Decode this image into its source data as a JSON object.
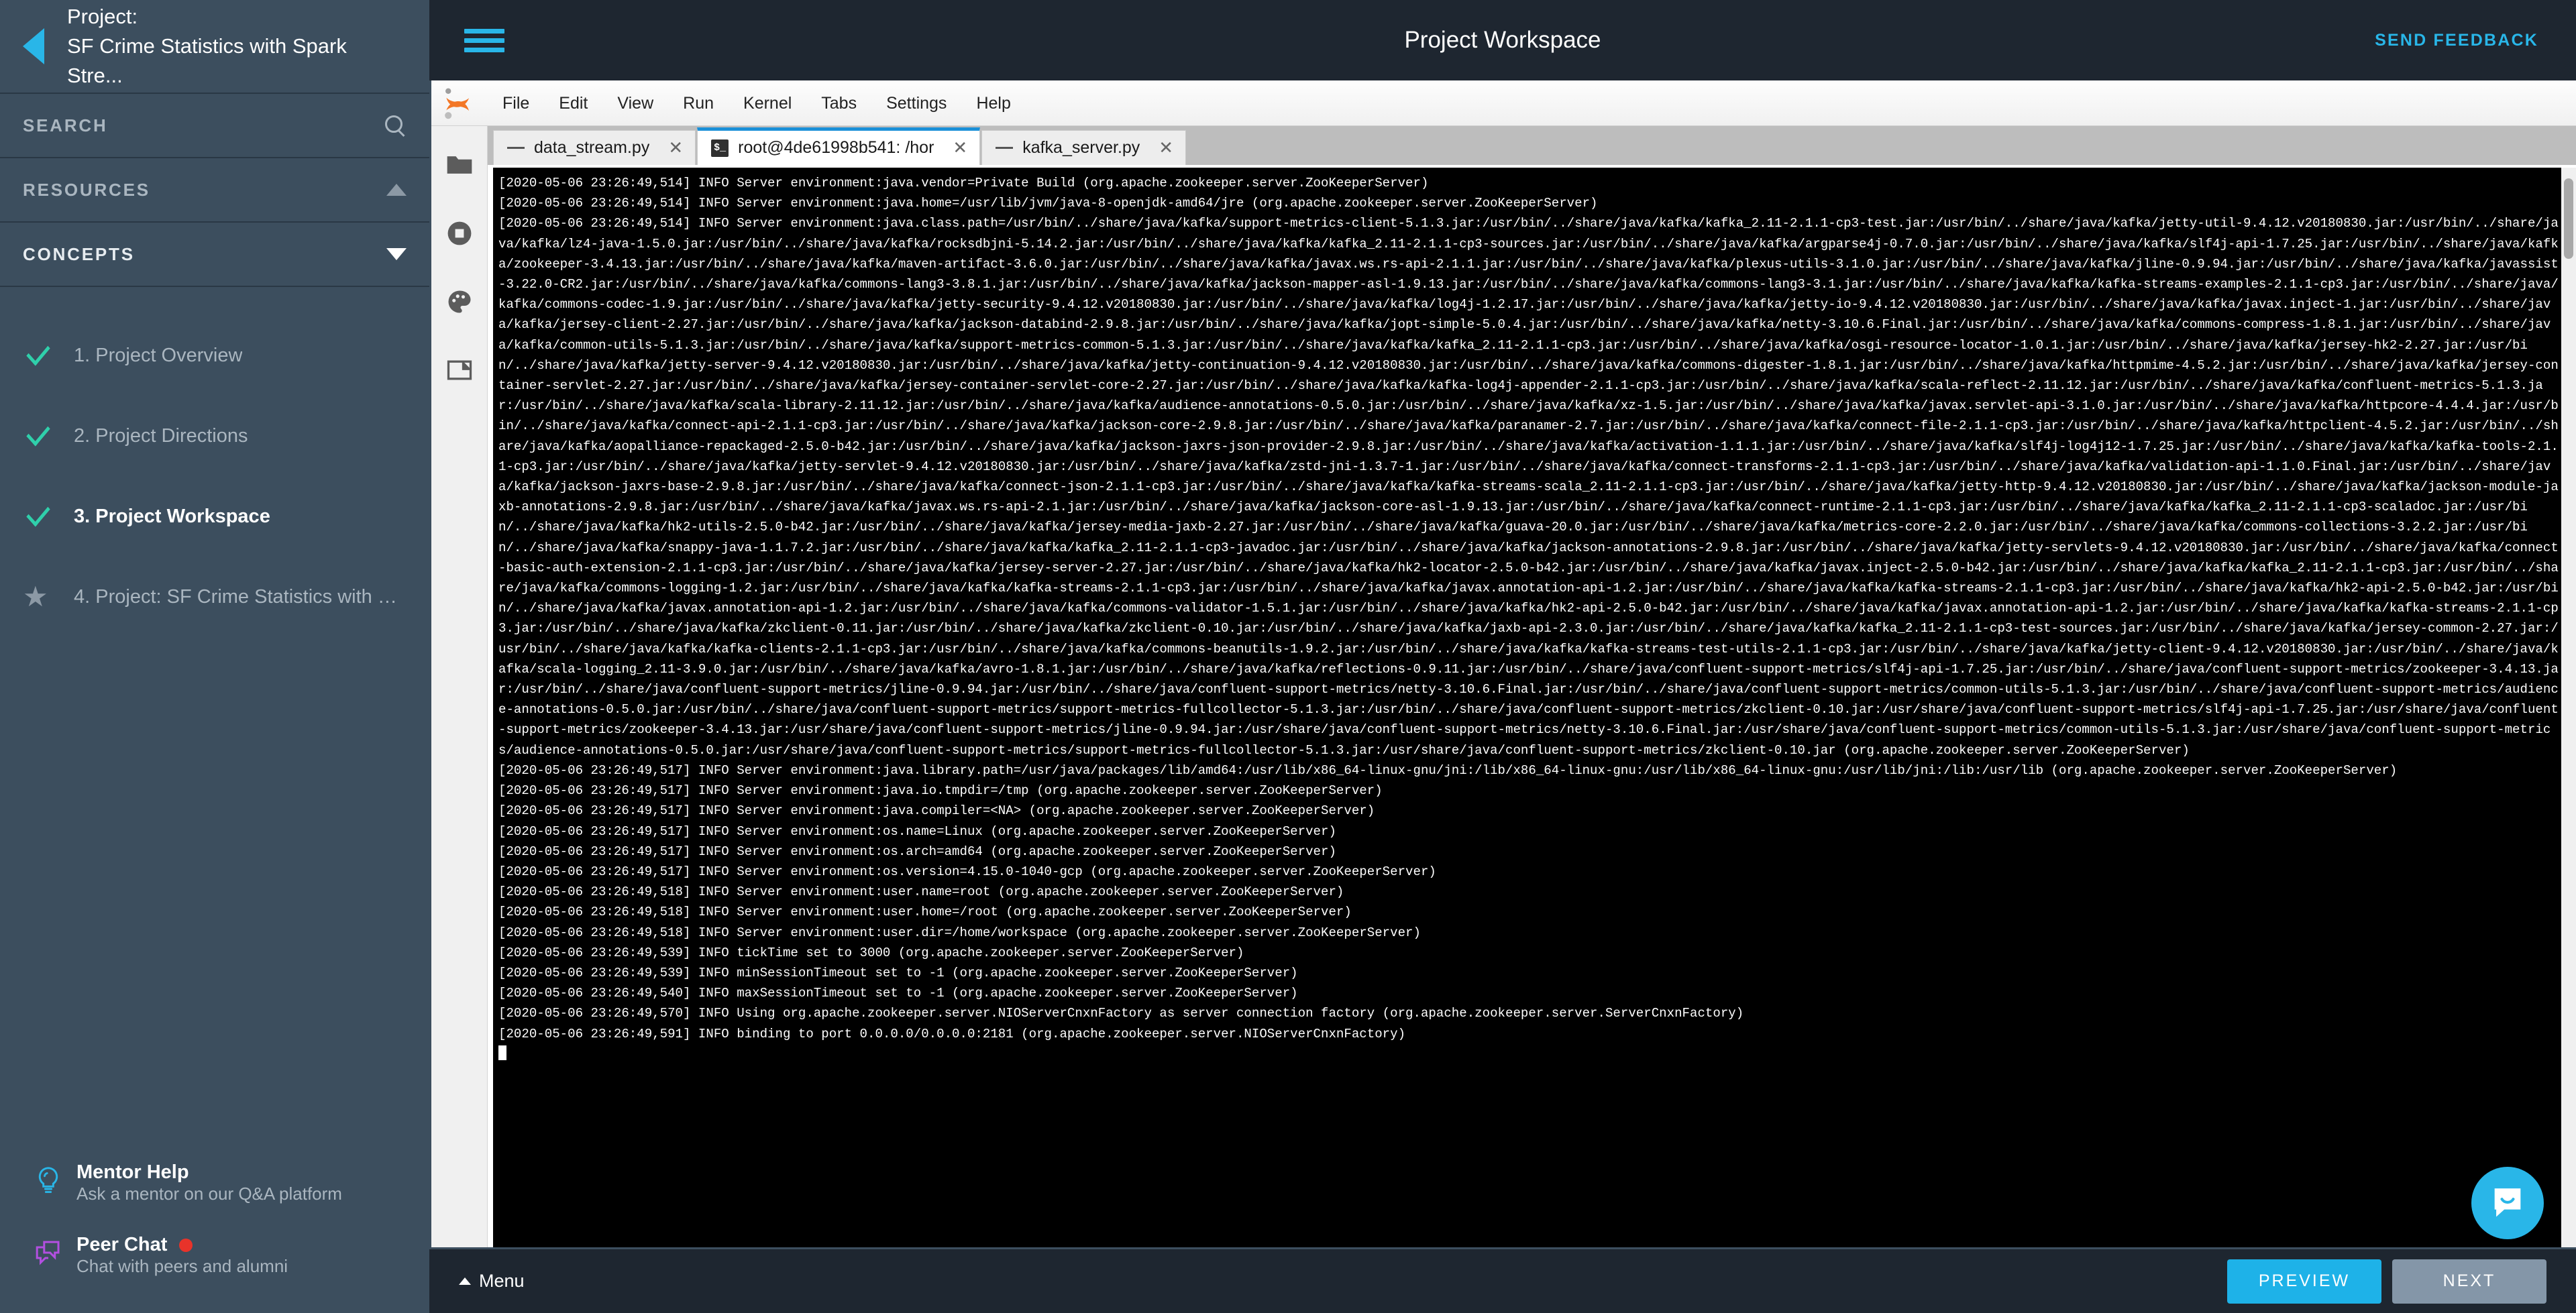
{
  "sidebar": {
    "project_label": "Project:",
    "project_name": "SF Crime Statistics with Spark Stre...",
    "back_icon": "back-arrow-icon",
    "search": {
      "label": "SEARCH",
      "icon": "search-icon"
    },
    "resources": {
      "label": "RESOURCES",
      "icon": "triangle-up-icon"
    },
    "concepts": {
      "label": "CONCEPTS",
      "icon": "triangle-down-icon"
    },
    "nav": [
      {
        "label": "1. Project Overview",
        "mark": "check",
        "active": false
      },
      {
        "label": "2. Project Directions",
        "mark": "check",
        "active": false
      },
      {
        "label": "3. Project Workspace",
        "mark": "check",
        "active": true
      },
      {
        "label": "4. Project: SF Crime Statistics with Sp...",
        "mark": "star",
        "active": false
      }
    ],
    "footer": [
      {
        "title": "Mentor Help",
        "subtitle": "Ask a mentor on our Q&A platform",
        "icon": "lightbulb-icon",
        "badge": false
      },
      {
        "title": "Peer Chat",
        "subtitle": "Chat with peers and alumni",
        "icon": "chat-bubbles-icon",
        "badge": true
      }
    ]
  },
  "header": {
    "menu_icon": "hamburger-icon",
    "title": "Project Workspace",
    "send_feedback": "SEND FEEDBACK"
  },
  "jupyter": {
    "logo": "jupyter-logo-icon",
    "menus": [
      "File",
      "Edit",
      "View",
      "Run",
      "Kernel",
      "Tabs",
      "Settings",
      "Help"
    ],
    "rail_icons": [
      "folder-icon",
      "running-stop-icon",
      "palette-icon",
      "open-tabs-icon"
    ],
    "tabs": [
      {
        "label": "data_stream.py",
        "icon": "file-text-icon",
        "active": false,
        "close": "✕"
      },
      {
        "label": "root@4de61998b541: /hor",
        "icon": "terminal-icon",
        "active": true,
        "close": "✕"
      },
      {
        "label": "kafka_server.py",
        "icon": "file-text-icon",
        "active": false,
        "close": "✕"
      }
    ],
    "terminal_text": "[2020-05-06 23:26:49,514] INFO Server environment:java.vendor=Private Build (org.apache.zookeeper.server.ZooKeeperServer)\n[2020-05-06 23:26:49,514] INFO Server environment:java.home=/usr/lib/jvm/java-8-openjdk-amd64/jre (org.apache.zookeeper.server.ZooKeeperServer)\n[2020-05-06 23:26:49,514] INFO Server environment:java.class.path=/usr/bin/../share/java/kafka/support-metrics-client-5.1.3.jar:/usr/bin/../share/java/kafka/kafka_2.11-2.1.1-cp3-test.jar:/usr/bin/../share/java/kafka/jetty-util-9.4.12.v20180830.jar:/usr/bin/../share/java/kafka/lz4-java-1.5.0.jar:/usr/bin/../share/java/kafka/rocksdbjni-5.14.2.jar:/usr/bin/../share/java/kafka/kafka_2.11-2.1.1-cp3-sources.jar:/usr/bin/../share/java/kafka/argparse4j-0.7.0.jar:/usr/bin/../share/java/kafka/slf4j-api-1.7.25.jar:/usr/bin/../share/java/kafka/zookeeper-3.4.13.jar:/usr/bin/../share/java/kafka/maven-artifact-3.6.0.jar:/usr/bin/../share/java/kafka/javax.ws.rs-api-2.1.1.jar:/usr/bin/../share/java/kafka/plexus-utils-3.1.0.jar:/usr/bin/../share/java/kafka/jline-0.9.94.jar:/usr/bin/../share/java/kafka/javassist-3.22.0-CR2.jar:/usr/bin/../share/java/kafka/commons-lang3-3.8.1.jar:/usr/bin/../share/java/kafka/jackson-mapper-asl-1.9.13.jar:/usr/bin/../share/java/kafka/commons-lang3-3.1.jar:/usr/bin/../share/java/kafka/kafka-streams-examples-2.1.1-cp3.jar:/usr/bin/../share/java/kafka/commons-codec-1.9.jar:/usr/bin/../share/java/kafka/jetty-security-9.4.12.v20180830.jar:/usr/bin/../share/java/kafka/log4j-1.2.17.jar:/usr/bin/../share/java/kafka/jetty-io-9.4.12.v20180830.jar:/usr/bin/../share/java/kafka/javax.inject-1.jar:/usr/bin/../share/java/kafka/jersey-client-2.27.jar:/usr/bin/../share/java/kafka/jackson-databind-2.9.8.jar:/usr/bin/../share/java/kafka/jopt-simple-5.0.4.jar:/usr/bin/../share/java/kafka/netty-3.10.6.Final.jar:/usr/bin/../share/java/kafka/commons-compress-1.8.1.jar:/usr/bin/../share/java/kafka/common-utils-5.1.3.jar:/usr/bin/../share/java/kafka/support-metrics-common-5.1.3.jar:/usr/bin/../share/java/kafka/kafka_2.11-2.1.1-cp3.jar:/usr/bin/../share/java/kafka/osgi-resource-locator-1.0.1.jar:/usr/bin/../share/java/kafka/jersey-hk2-2.27.jar:/usr/bin/../share/java/kafka/jetty-server-9.4.12.v20180830.jar:/usr/bin/../share/java/kafka/jetty-continuation-9.4.12.v20180830.jar:/usr/bin/../share/java/kafka/commons-digester-1.8.1.jar:/usr/bin/../share/java/kafka/httpmime-4.5.2.jar:/usr/bin/../share/java/kafka/jersey-container-servlet-2.27.jar:/usr/bin/../share/java/kafka/jersey-container-servlet-core-2.27.jar:/usr/bin/../share/java/kafka/kafka-log4j-appender-2.1.1-cp3.jar:/usr/bin/../share/java/kafka/scala-reflect-2.11.12.jar:/usr/bin/../share/java/kafka/confluent-metrics-5.1.3.jar:/usr/bin/../share/java/kafka/scala-library-2.11.12.jar:/usr/bin/../share/java/kafka/audience-annotations-0.5.0.jar:/usr/bin/../share/java/kafka/xz-1.5.jar:/usr/bin/../share/java/kafka/javax.servlet-api-3.1.0.jar:/usr/bin/../share/java/kafka/httpcore-4.4.4.jar:/usr/bin/../share/java/kafka/connect-api-2.1.1-cp3.jar:/usr/bin/../share/java/kafka/jackson-core-2.9.8.jar:/usr/bin/../share/java/kafka/paranamer-2.7.jar:/usr/bin/../share/java/kafka/connect-file-2.1.1-cp3.jar:/usr/bin/../share/java/kafka/httpclient-4.5.2.jar:/usr/bin/../share/java/kafka/aopalliance-repackaged-2.5.0-b42.jar:/usr/bin/../share/java/kafka/jackson-jaxrs-json-provider-2.9.8.jar:/usr/bin/../share/java/kafka/activation-1.1.1.jar:/usr/bin/../share/java/kafka/slf4j-log4j12-1.7.25.jar:/usr/bin/../share/java/kafka/kafka-tools-2.1.1-cp3.jar:/usr/bin/../share/java/kafka/jetty-servlet-9.4.12.v20180830.jar:/usr/bin/../share/java/kafka/zstd-jni-1.3.7-1.jar:/usr/bin/../share/java/kafka/connect-transforms-2.1.1-cp3.jar:/usr/bin/../share/java/kafka/validation-api-1.1.0.Final.jar:/usr/bin/../share/java/kafka/jackson-jaxrs-base-2.9.8.jar:/usr/bin/../share/java/kafka/connect-json-2.1.1-cp3.jar:/usr/bin/../share/java/kafka/kafka-streams-scala_2.11-2.1.1-cp3.jar:/usr/bin/../share/java/kafka/jetty-http-9.4.12.v20180830.jar:/usr/bin/../share/java/kafka/jackson-module-jaxb-annotations-2.9.8.jar:/usr/bin/../share/java/kafka/javax.ws.rs-api-2.1.jar:/usr/bin/../share/java/kafka/jackson-core-asl-1.9.13.jar:/usr/bin/../share/java/kafka/connect-runtime-2.1.1-cp3.jar:/usr/bin/../share/java/kafka/kafka_2.11-2.1.1-cp3-scaladoc.jar:/usr/bin/../share/java/kafka/hk2-utils-2.5.0-b42.jar:/usr/bin/../share/java/kafka/jersey-media-jaxb-2.27.jar:/usr/bin/../share/java/kafka/guava-20.0.jar:/usr/bin/../share/java/kafka/metrics-core-2.2.0.jar:/usr/bin/../share/java/kafka/commons-collections-3.2.2.jar:/usr/bin/../share/java/kafka/snappy-java-1.1.7.2.jar:/usr/bin/../share/java/kafka/kafka_2.11-2.1.1-cp3-javadoc.jar:/usr/bin/../share/java/kafka/jackson-annotations-2.9.8.jar:/usr/bin/../share/java/kafka/jetty-servlets-9.4.12.v20180830.jar:/usr/bin/../share/java/kafka/connect-basic-auth-extension-2.1.1-cp3.jar:/usr/bin/../share/java/kafka/jersey-server-2.27.jar:/usr/bin/../share/java/kafka/hk2-locator-2.5.0-b42.jar:/usr/bin/../share/java/kafka/javax.inject-2.5.0-b42.jar:/usr/bin/../share/java/kafka/kafka_2.11-2.1.1-cp3.jar:/usr/bin/../share/java/kafka/commons-logging-1.2.jar:/usr/bin/../share/java/kafka/kafka-streams-2.1.1-cp3.jar:/usr/bin/../share/java/kafka/javax.annotation-api-1.2.jar:/usr/bin/../share/java/kafka/kafka-streams-2.1.1-cp3.jar:/usr/bin/../share/java/kafka/hk2-api-2.5.0-b42.jar:/usr/bin/../share/java/kafka/javax.annotation-api-1.2.jar:/usr/bin/../share/java/kafka/commons-validator-1.5.1.jar:/usr/bin/../share/java/kafka/hk2-api-2.5.0-b42.jar:/usr/bin/../share/java/kafka/javax.annotation-api-1.2.jar:/usr/bin/../share/java/kafka/kafka-streams-2.1.1-cp3.jar:/usr/bin/../share/java/kafka/zkclient-0.11.jar:/usr/bin/../share/java/kafka/zkclient-0.10.jar:/usr/bin/../share/java/kafka/jaxb-api-2.3.0.jar:/usr/bin/../share/java/kafka/kafka_2.11-2.1.1-cp3-test-sources.jar:/usr/bin/../share/java/kafka/jersey-common-2.27.jar:/usr/bin/../share/java/kafka/kafka-clients-2.1.1-cp3.jar:/usr/bin/../share/java/kafka/commons-beanutils-1.9.2.jar:/usr/bin/../share/java/kafka/kafka-streams-test-utils-2.1.1-cp3.jar:/usr/bin/../share/java/kafka/jetty-client-9.4.12.v20180830.jar:/usr/bin/../share/java/kafka/scala-logging_2.11-3.9.0.jar:/usr/bin/../share/java/kafka/avro-1.8.1.jar:/usr/bin/../share/java/kafka/reflections-0.9.11.jar:/usr/bin/../share/java/confluent-support-metrics/slf4j-api-1.7.25.jar:/usr/bin/../share/java/confluent-support-metrics/zookeeper-3.4.13.jar:/usr/bin/../share/java/confluent-support-metrics/jline-0.9.94.jar:/usr/bin/../share/java/confluent-support-metrics/netty-3.10.6.Final.jar:/usr/bin/../share/java/confluent-support-metrics/common-utils-5.1.3.jar:/usr/bin/../share/java/confluent-support-metrics/audience-annotations-0.5.0.jar:/usr/bin/../share/java/confluent-support-metrics/support-metrics-fullcollector-5.1.3.jar:/usr/bin/../share/java/confluent-support-metrics/zkclient-0.10.jar:/usr/share/java/confluent-support-metrics/slf4j-api-1.7.25.jar:/usr/share/java/confluent-support-metrics/zookeeper-3.4.13.jar:/usr/share/java/confluent-support-metrics/jline-0.9.94.jar:/usr/share/java/confluent-support-metrics/netty-3.10.6.Final.jar:/usr/share/java/confluent-support-metrics/common-utils-5.1.3.jar:/usr/share/java/confluent-support-metrics/audience-annotations-0.5.0.jar:/usr/share/java/confluent-support-metrics/support-metrics-fullcollector-5.1.3.jar:/usr/share/java/confluent-support-metrics/zkclient-0.10.jar (org.apache.zookeeper.server.ZooKeeperServer)\n[2020-05-06 23:26:49,517] INFO Server environment:java.library.path=/usr/java/packages/lib/amd64:/usr/lib/x86_64-linux-gnu/jni:/lib/x86_64-linux-gnu:/usr/lib/x86_64-linux-gnu:/usr/lib/jni:/lib:/usr/lib (org.apache.zookeeper.server.ZooKeeperServer)\n[2020-05-06 23:26:49,517] INFO Server environment:java.io.tmpdir=/tmp (org.apache.zookeeper.server.ZooKeeperServer)\n[2020-05-06 23:26:49,517] INFO Server environment:java.compiler=<NA> (org.apache.zookeeper.server.ZooKeeperServer)\n[2020-05-06 23:26:49,517] INFO Server environment:os.name=Linux (org.apache.zookeeper.server.ZooKeeperServer)\n[2020-05-06 23:26:49,517] INFO Server environment:os.arch=amd64 (org.apache.zookeeper.server.ZooKeeperServer)\n[2020-05-06 23:26:49,517] INFO Server environment:os.version=4.15.0-1040-gcp (org.apache.zookeeper.server.ZooKeeperServer)\n[2020-05-06 23:26:49,518] INFO Server environment:user.name=root (org.apache.zookeeper.server.ZooKeeperServer)\n[2020-05-06 23:26:49,518] INFO Server environment:user.home=/root (org.apache.zookeeper.server.ZooKeeperServer)\n[2020-05-06 23:26:49,518] INFO Server environment:user.dir=/home/workspace (org.apache.zookeeper.server.ZooKeeperServer)\n[2020-05-06 23:26:49,539] INFO tickTime set to 3000 (org.apache.zookeeper.server.ZooKeeperServer)\n[2020-05-06 23:26:49,539] INFO minSessionTimeout set to -1 (org.apache.zookeeper.server.ZooKeeperServer)\n[2020-05-06 23:26:49,540] INFO maxSessionTimeout set to -1 (org.apache.zookeeper.server.ZooKeeperServer)\n[2020-05-06 23:26:49,570] INFO Using org.apache.zookeeper.server.NIOServerCnxnFactory as server connection factory (org.apache.zookeeper.server.ServerCnxnFactory)\n[2020-05-06 23:26:49,591] INFO binding to port 0.0.0.0/0.0.0.0:2181 (org.apache.zookeeper.server.NIOServerCnxnFactory)\n"
  },
  "bottom": {
    "menu_label": "Menu",
    "preview_label": "PREVIEW",
    "next_label": "NEXT",
    "chat_icon": "chat-widget-icon"
  },
  "colors": {
    "accent": "#29b6e8",
    "sidebar_bg": "#3c4e5e",
    "header_bg": "#1e2630",
    "check": "#2fd0ab",
    "badge_red": "#e8332a",
    "next_btn": "#8496a8"
  }
}
